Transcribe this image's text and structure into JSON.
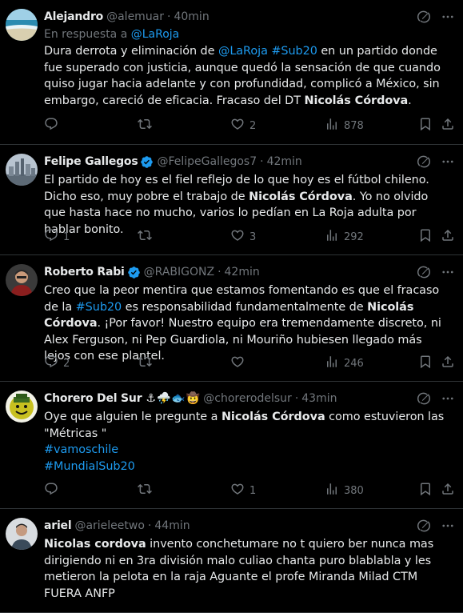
{
  "colors": {
    "background": "#000000",
    "text": "#e7e9ea",
    "muted": "#71767b",
    "link": "#1d9bf0",
    "divider": "#2f3336",
    "verified": "#1d9bf0"
  },
  "tweets": [
    {
      "name": "Alejandro",
      "handle": "@alemuar",
      "dot": "·",
      "time": "40min",
      "reply_prefix": "En respuesta a",
      "reply_to": "@LaRoja",
      "body": [
        {
          "t": "Dura derrota y eliminación de "
        },
        {
          "t": "@LaRoja",
          "link": true
        },
        {
          "t": " "
        },
        {
          "t": "#Sub20",
          "link": true
        },
        {
          "t": " en un partido donde fue superado con justicia, aunque quedó la sensación de que cuando quiso jugar hacia adelante y con profundidad, complicó a México, sin embargo, careció de eficacia. Fracaso del DT "
        },
        {
          "t": "Nicolás Córdova",
          "bold": true
        },
        {
          "t": "."
        }
      ],
      "replies": "",
      "reposts": "",
      "likes": "2",
      "views": "878"
    },
    {
      "name": "Felipe Gallegos",
      "verified": true,
      "handle": "@FelipeGallegos7",
      "dot": "·",
      "time": "42min",
      "body": [
        {
          "t": "El partido de hoy es el fiel reflejo de lo que hoy es el fútbol chileno. Dicho eso, muy pobre el trabajo de "
        },
        {
          "t": "Nicolás Córdova",
          "bold": true
        },
        {
          "t": ". Yo no olvido que hasta hace no mucho, varios lo pedían en La Roja adulta por hablar bonito."
        }
      ],
      "replies": "1",
      "reposts": "",
      "likes": "3",
      "views": "292"
    },
    {
      "name": "Roberto Rabi",
      "verified": true,
      "handle": "@RABIGONZ",
      "dot": "·",
      "time": "42min",
      "body": [
        {
          "t": "Creo que la peor mentira que estamos fomentando es que el fracaso de la "
        },
        {
          "t": "#Sub20",
          "link": true
        },
        {
          "t": " es responsabilidad fundamentalmente de "
        },
        {
          "t": "Nicolás Córdova",
          "bold": true
        },
        {
          "t": ". ¡Por favor! Nuestro equipo era tremendamente discreto, ni Alex Ferguson, ni Pep Guardiola, ni Mouriño hubiesen llegado más lejos con ese plantel."
        }
      ],
      "replies": "2",
      "reposts": "",
      "likes": "",
      "views": "246"
    },
    {
      "name": "Chorero Del Sur",
      "emojis": [
        "⚓",
        "⛈️",
        "🐟",
        "🤠"
      ],
      "handle": "@chorerodelsur",
      "dot": "·",
      "time": "43min",
      "body": [
        {
          "t": "Oye que alguien le pregunte a "
        },
        {
          "t": "Nicolás Córdova",
          "bold": true
        },
        {
          "t": " como estuvieron las \"Métricas \""
        },
        {
          "br": true
        },
        {
          "t": "#vamoschile",
          "link": true
        },
        {
          "br": true
        },
        {
          "t": "#MundialSub20",
          "link": true
        }
      ],
      "replies": "",
      "reposts": "",
      "likes": "1",
      "views": "380"
    },
    {
      "name": "ariel",
      "handle": "@arieleetwo",
      "dot": "·",
      "time": "44min",
      "body": [
        {
          "t": "Nicolas cordova",
          "bold": true
        },
        {
          "t": " invento conchetumare no t quiero ber nunca mas dirigiendo ni en 3ra división malo culiao chanta puro blablabla y les metieron la pelota en la raja Aguante el profe Miranda Milad CTM FUERA ANFP"
        }
      ]
    }
  ],
  "icons": {
    "grok": "grok-icon",
    "more": "more-icon",
    "reply": "reply-icon",
    "repost": "repost-icon",
    "like": "like-icon",
    "views": "views-icon",
    "bookmark": "bookmark-icon",
    "share": "share-icon"
  }
}
